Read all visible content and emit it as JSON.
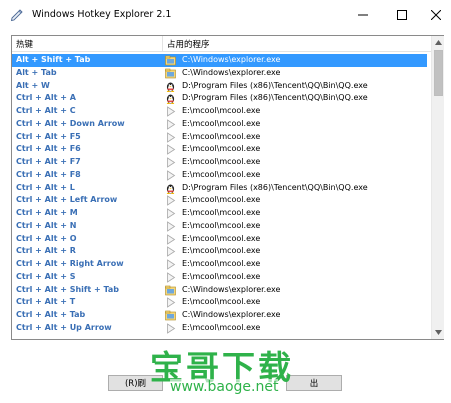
{
  "window": {
    "title": "Windows Hotkey Explorer 2.1"
  },
  "list": {
    "header": {
      "col1": "热键",
      "col2": "占用的程序"
    },
    "rows": [
      {
        "hotkey": "Alt + Shift + Tab",
        "icon": "explorer-icon",
        "path": "C:\\Windows\\explorer.exe",
        "selected": true
      },
      {
        "hotkey": "Alt + Tab",
        "icon": "explorer-icon",
        "path": "C:\\Windows\\explorer.exe",
        "selected": false
      },
      {
        "hotkey": "Alt + W",
        "icon": "qq-penguin-icon",
        "path": "D:\\Program Files (x86)\\Tencent\\QQ\\Bin\\QQ.exe",
        "selected": false
      },
      {
        "hotkey": "Ctrl + Alt + A",
        "icon": "qq-penguin-icon",
        "path": "D:\\Program Files (x86)\\Tencent\\QQ\\Bin\\QQ.exe",
        "selected": false
      },
      {
        "hotkey": "Ctrl + Alt + C",
        "icon": "play-arrow-icon",
        "path": "E:\\mcool\\mcool.exe",
        "selected": false
      },
      {
        "hotkey": "Ctrl + Alt + Down Arrow",
        "icon": "play-arrow-icon",
        "path": "E:\\mcool\\mcool.exe",
        "selected": false
      },
      {
        "hotkey": "Ctrl + Alt + F5",
        "icon": "play-arrow-icon",
        "path": "E:\\mcool\\mcool.exe",
        "selected": false
      },
      {
        "hotkey": "Ctrl + Alt + F6",
        "icon": "play-arrow-icon",
        "path": "E:\\mcool\\mcool.exe",
        "selected": false
      },
      {
        "hotkey": "Ctrl + Alt + F7",
        "icon": "play-arrow-icon",
        "path": "E:\\mcool\\mcool.exe",
        "selected": false
      },
      {
        "hotkey": "Ctrl + Alt + F8",
        "icon": "play-arrow-icon",
        "path": "E:\\mcool\\mcool.exe",
        "selected": false
      },
      {
        "hotkey": "Ctrl + Alt + L",
        "icon": "qq-penguin-icon",
        "path": "D:\\Program Files (x86)\\Tencent\\QQ\\Bin\\QQ.exe",
        "selected": false
      },
      {
        "hotkey": "Ctrl + Alt + Left Arrow",
        "icon": "play-arrow-icon",
        "path": "E:\\mcool\\mcool.exe",
        "selected": false
      },
      {
        "hotkey": "Ctrl + Alt + M",
        "icon": "play-arrow-icon",
        "path": "E:\\mcool\\mcool.exe",
        "selected": false
      },
      {
        "hotkey": "Ctrl + Alt + N",
        "icon": "play-arrow-icon",
        "path": "E:\\mcool\\mcool.exe",
        "selected": false
      },
      {
        "hotkey": "Ctrl + Alt + O",
        "icon": "play-arrow-icon",
        "path": "E:\\mcool\\mcool.exe",
        "selected": false
      },
      {
        "hotkey": "Ctrl + Alt + R",
        "icon": "play-arrow-icon",
        "path": "E:\\mcool\\mcool.exe",
        "selected": false
      },
      {
        "hotkey": "Ctrl + Alt + Right Arrow",
        "icon": "play-arrow-icon",
        "path": "E:\\mcool\\mcool.exe",
        "selected": false
      },
      {
        "hotkey": "Ctrl + Alt + S",
        "icon": "play-arrow-icon",
        "path": "E:\\mcool\\mcool.exe",
        "selected": false
      },
      {
        "hotkey": "Ctrl + Alt + Shift + Tab",
        "icon": "explorer-icon",
        "path": "C:\\Windows\\explorer.exe",
        "selected": false
      },
      {
        "hotkey": "Ctrl + Alt + T",
        "icon": "play-arrow-icon",
        "path": "E:\\mcool\\mcool.exe",
        "selected": false
      },
      {
        "hotkey": "Ctrl + Alt + Tab",
        "icon": "explorer-icon",
        "path": "C:\\Windows\\explorer.exe",
        "selected": false
      },
      {
        "hotkey": "Ctrl + Alt + Up Arrow",
        "icon": "play-arrow-icon",
        "path": "E:\\mcool\\mcool.exe",
        "selected": false
      }
    ]
  },
  "buttons": {
    "refresh_label": "(R)刷",
    "right_label": "出"
  },
  "watermark": {
    "title": "宝哥下载",
    "url": "www.baoge.net"
  },
  "colors": {
    "selection": "#3399ff",
    "hotkey_text": "#3a6fb5",
    "watermark": "#2fb24a"
  }
}
